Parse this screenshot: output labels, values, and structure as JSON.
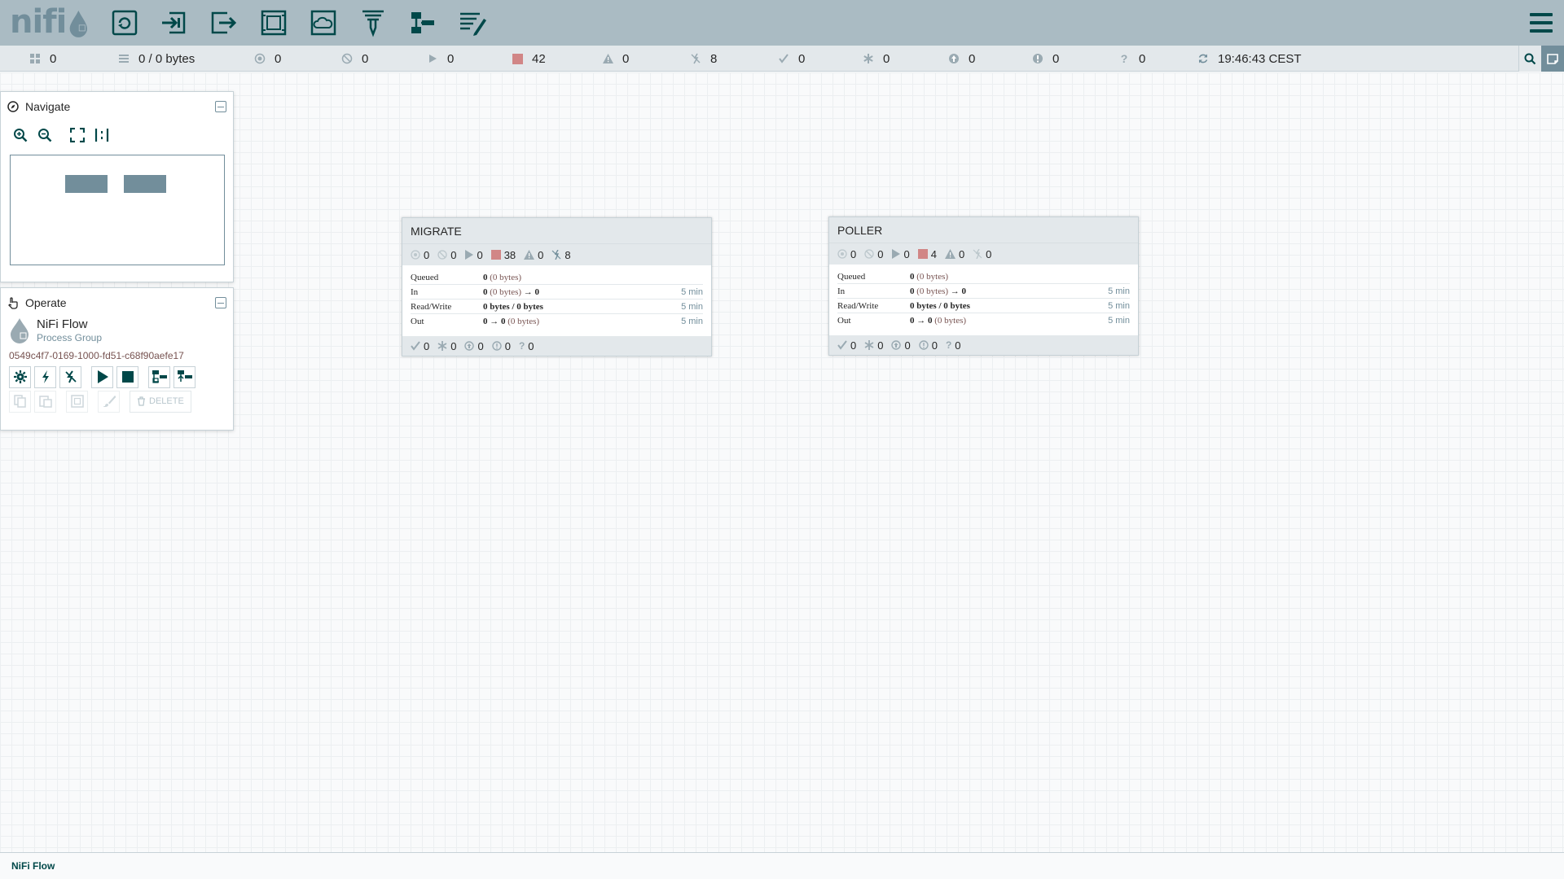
{
  "app": {
    "logo_text": "nifi",
    "toolbar": [
      {
        "name": "processor-tool",
        "icon": "processor-icon"
      },
      {
        "name": "input-port-tool",
        "icon": "input-port-icon"
      },
      {
        "name": "output-port-tool",
        "icon": "output-port-icon"
      },
      {
        "name": "process-group-tool",
        "icon": "process-group-icon"
      },
      {
        "name": "remote-process-group-tool",
        "icon": "remote-process-group-icon"
      },
      {
        "name": "funnel-tool",
        "icon": "funnel-icon"
      },
      {
        "name": "template-tool",
        "icon": "template-icon"
      },
      {
        "name": "label-tool",
        "icon": "label-icon"
      }
    ]
  },
  "status": {
    "transmitting": "0",
    "queued": "0 / 0 bytes",
    "running_remote": "0",
    "not_transmitting": "0",
    "running": "0",
    "stopped": "42",
    "invalid": "0",
    "disabled": "8",
    "up_to_date": "0",
    "locally_modified": "0",
    "stale": "0",
    "locally_modified_stale": "0",
    "sync_failure": "0",
    "refreshed": "19:46:43 CEST"
  },
  "navigate": {
    "title": "Navigate"
  },
  "operate": {
    "title": "Operate",
    "name": "NiFi Flow",
    "type": "Process Group",
    "id": "0549c4f7-0169-1000-fd51-c68f90aefe17",
    "delete_label": "DELETE"
  },
  "groups": [
    {
      "title": "MIGRATE",
      "transmitting": "0",
      "not_transmitting": "0",
      "running": "0",
      "stopped": "38",
      "invalid": "0",
      "disabled": "8",
      "queued_label": "Queued",
      "queued_count": "0",
      "queued_size": "(0 bytes)",
      "in_label": "In",
      "in_count": "0",
      "in_size": "(0 bytes)",
      "in_arrow": "→",
      "in_ports": "0",
      "in_time": "5 min",
      "rw_label": "Read/Write",
      "rw_value": "0 bytes / 0 bytes",
      "rw_time": "5 min",
      "out_label": "Out",
      "out_ports": "0",
      "out_arrow": "→",
      "out_count": "0",
      "out_size": "(0 bytes)",
      "out_time": "5 min",
      "up_to_date": "0",
      "locally_modified": "0",
      "stale": "0",
      "locally_modified_stale": "0",
      "sync_failure": "0"
    },
    {
      "title": "POLLER",
      "transmitting": "0",
      "not_transmitting": "0",
      "running": "0",
      "stopped": "4",
      "invalid": "0",
      "disabled": "0",
      "queued_label": "Queued",
      "queued_count": "0",
      "queued_size": "(0 bytes)",
      "in_label": "In",
      "in_count": "0",
      "in_size": "(0 bytes)",
      "in_arrow": "→",
      "in_ports": "0",
      "in_time": "5 min",
      "rw_label": "Read/Write",
      "rw_value": "0 bytes / 0 bytes",
      "rw_time": "5 min",
      "out_label": "Out",
      "out_ports": "0",
      "out_arrow": "→",
      "out_count": "0",
      "out_size": "(0 bytes)",
      "out_time": "5 min",
      "up_to_date": "0",
      "locally_modified": "0",
      "stale": "0",
      "locally_modified_stale": "0",
      "sync_failure": "0"
    }
  ],
  "breadcrumb": "NiFi Flow",
  "colors": {
    "header": "#aabbc3",
    "icon": "#004849",
    "stopped": "#d18686",
    "accent": "#728e9b"
  }
}
